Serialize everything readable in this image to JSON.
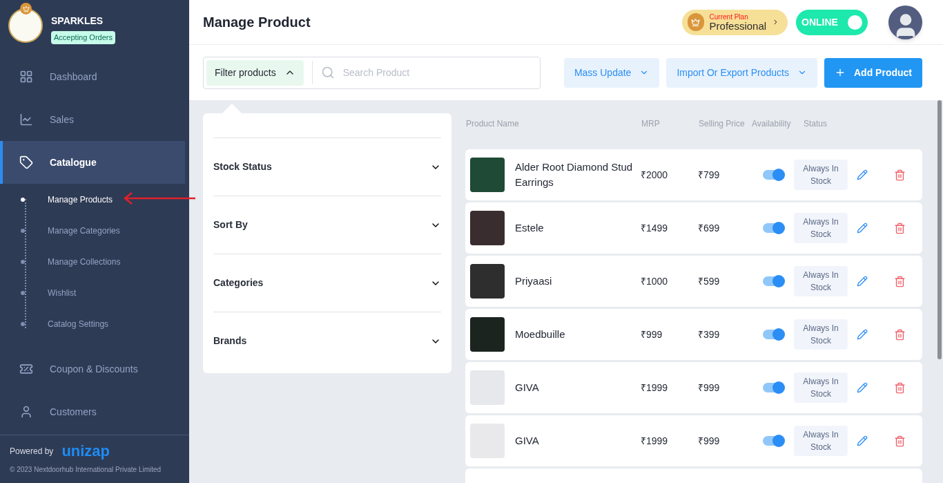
{
  "store": {
    "name": "SPARKLES",
    "status": "Accepting Orders"
  },
  "nav": [
    {
      "label": "Dashboard",
      "selected": false
    },
    {
      "label": "Sales",
      "selected": false
    },
    {
      "label": "Catalogue",
      "selected": true,
      "expanded": true,
      "children": [
        {
          "label": "Manage Products",
          "selected": true
        },
        {
          "label": "Manage Categories",
          "selected": false
        },
        {
          "label": "Manage Collections",
          "selected": false
        },
        {
          "label": "Wishlist",
          "selected": false
        },
        {
          "label": "Catalog Settings",
          "selected": false
        }
      ]
    },
    {
      "label": "Coupon & Discounts",
      "selected": false
    },
    {
      "label": "Customers",
      "selected": false
    }
  ],
  "footer": {
    "powered_by": "Powered by",
    "logo": "unizap",
    "copyright": "© 2023 Nextdoorhub International Private Limited"
  },
  "header": {
    "title": "Manage Product",
    "plan_label": "Current Plan",
    "plan": "Professional",
    "online_label": "ONLINE",
    "online": true
  },
  "toolbar": {
    "filter": "Filter products",
    "filter_expanded": true,
    "search_placeholder": "Search Product",
    "mass_update": "Mass Update",
    "import_export": "Import Or Export Products",
    "add": "Add Product"
  },
  "filter_sections": [
    {
      "label": "Stock Status",
      "expanded": false
    },
    {
      "label": "Sort By",
      "expanded": false
    },
    {
      "label": "Categories",
      "expanded": false
    },
    {
      "label": "Brands",
      "expanded": false
    }
  ],
  "table": {
    "columns": [
      "Product Name",
      "MRP",
      "Selling Price",
      "Availability",
      "Status"
    ],
    "rows": [
      {
        "name": "Alder Root Diamond Stud Earrings",
        "mrp": "₹2000",
        "price": "₹799",
        "available": true,
        "status": "Always In Stock"
      },
      {
        "name": "Estele",
        "mrp": "₹1499",
        "price": "₹699",
        "available": true,
        "status": "Always In Stock"
      },
      {
        "name": "Priyaasi",
        "mrp": "₹1000",
        "price": "₹599",
        "available": true,
        "status": "Always In Stock"
      },
      {
        "name": "Moedbuille",
        "mrp": "₹999",
        "price": "₹399",
        "available": true,
        "status": "Always In Stock"
      },
      {
        "name": "GIVA",
        "mrp": "₹1999",
        "price": "₹999",
        "available": true,
        "status": "Always In Stock"
      },
      {
        "name": "GIVA",
        "mrp": "₹1999",
        "price": "₹999",
        "available": true,
        "status": "Always In Stock"
      }
    ]
  }
}
